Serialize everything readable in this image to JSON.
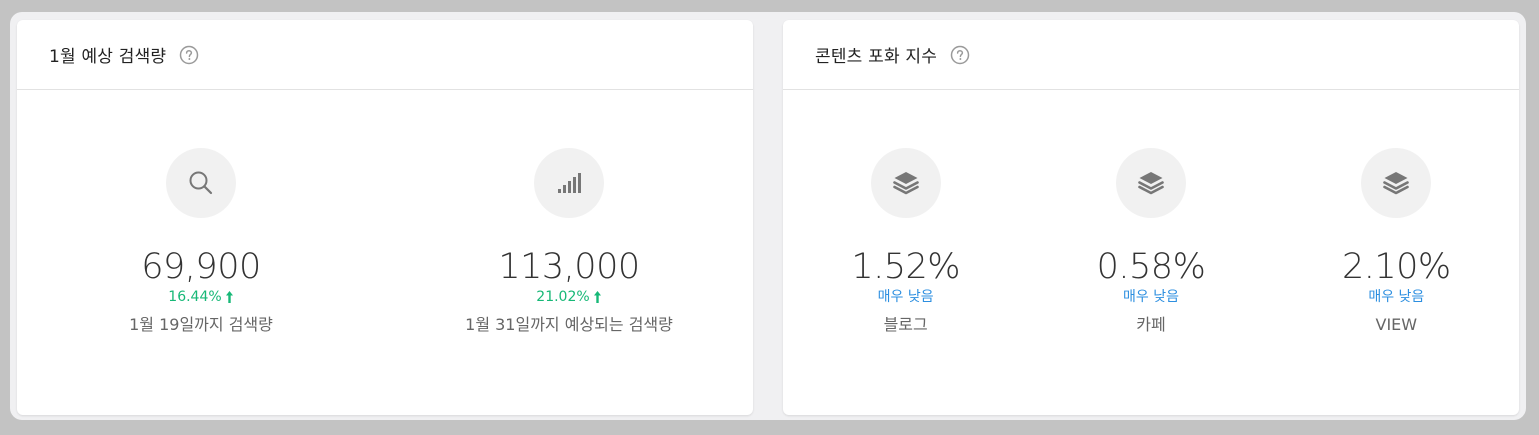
{
  "search_card": {
    "title": "1월 예상 검색량",
    "stats": [
      {
        "icon": "search-icon",
        "value": "69,900",
        "change": "16.44%",
        "change_direction": "up",
        "caption": "1월 19일까지 검색량"
      },
      {
        "icon": "signal-bars-icon",
        "value": "113,000",
        "change": "21.02%",
        "change_direction": "up",
        "caption": "1월 31일까지 예상되는 검색량"
      }
    ]
  },
  "saturation_card": {
    "title": "콘텐츠 포화 지수",
    "stats": [
      {
        "icon": "layers-icon",
        "value": "1.52%",
        "level": "매우 낮음",
        "caption": "블로그"
      },
      {
        "icon": "layers-icon",
        "value": "0.58%",
        "level": "매우 낮음",
        "caption": "카페"
      },
      {
        "icon": "layers-icon",
        "value": "2.10%",
        "level": "매우 낮음",
        "caption": "VIEW"
      }
    ]
  },
  "colors": {
    "increase": "#17b877",
    "level": "#2d8fe0",
    "icon": "#777777",
    "icon_background": "#f1f1f1"
  }
}
